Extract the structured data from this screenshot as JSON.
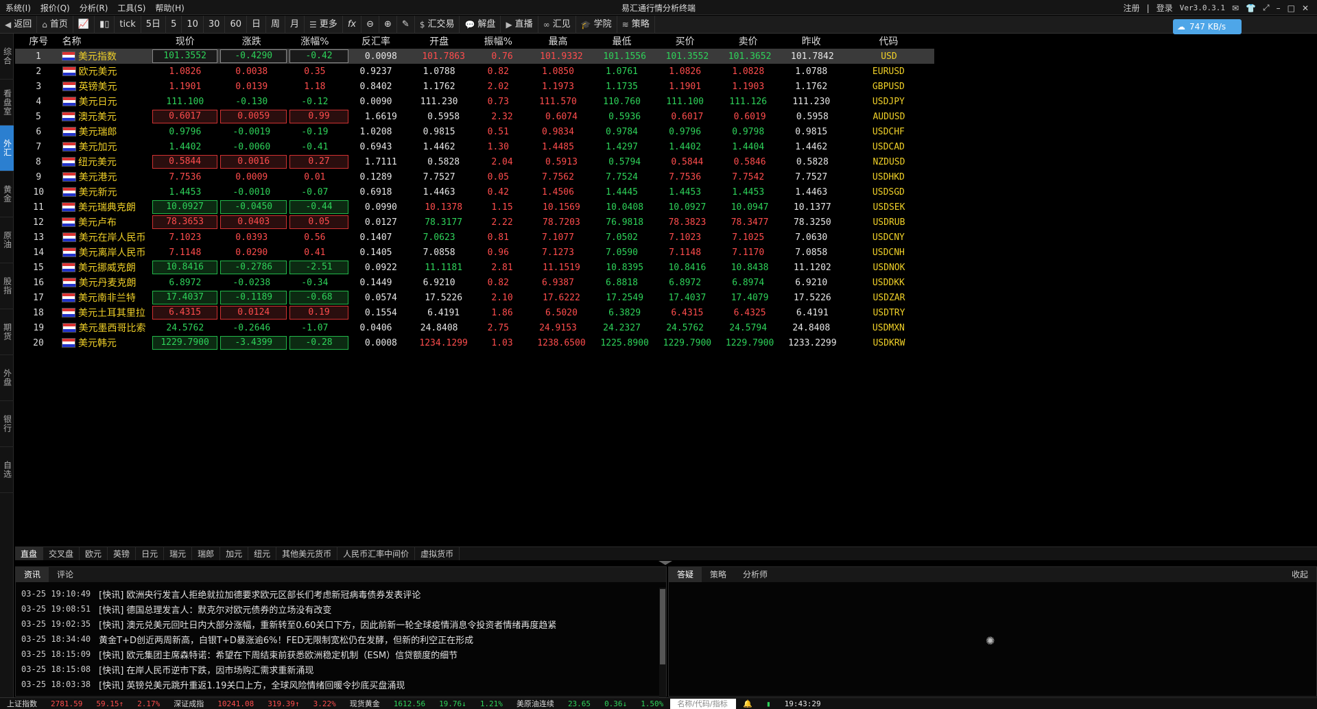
{
  "window": {
    "title": "易汇通行情分析终端",
    "version": "Ver3.0.3.1",
    "register": "注册",
    "login": "登录"
  },
  "menu": [
    "系统(I)",
    "报价(Q)",
    "分析(R)",
    "工具(S)",
    "帮助(H)"
  ],
  "toolbar": {
    "back": "返回",
    "home": "首页",
    "tick": "tick",
    "intervals": [
      "5日",
      "5",
      "10",
      "30",
      "60",
      "日",
      "周",
      "月"
    ],
    "more": "更多",
    "fx": "fx",
    "items": [
      "汇交易",
      "解盘",
      "直播",
      "汇见",
      "学院",
      "策略"
    ]
  },
  "speed": "747 KB/s",
  "sidebar": [
    "综合",
    "看盘室",
    "外汇",
    "黄金",
    "原油",
    "股指",
    "期货",
    "外盘",
    "银行",
    "自选"
  ],
  "columns": [
    "序号",
    "名称",
    "现价",
    "涨跌",
    "涨幅%",
    "反汇率",
    "开盘",
    "振幅%",
    "最高",
    "最低",
    "买价",
    "卖价",
    "昨收",
    "代码"
  ],
  "rows": [
    {
      "i": "1",
      "name": "美元指数",
      "price": "101.3552",
      "chg": "-0.4290",
      "pct": "-0.42",
      "inv": "0.0098",
      "open": "101.7863",
      "amp": "0.76",
      "high": "101.9332",
      "low": "101.1556",
      "bid": "101.3552",
      "ask": "101.3652",
      "prev": "101.7842",
      "code": "USD"
    },
    {
      "i": "2",
      "name": "欧元美元",
      "price": "1.0826",
      "chg": "0.0038",
      "pct": "0.35",
      "inv": "0.9237",
      "open": "1.0788",
      "amp": "0.82",
      "high": "1.0850",
      "low": "1.0761",
      "bid": "1.0826",
      "ask": "1.0828",
      "prev": "1.0788",
      "code": "EURUSD"
    },
    {
      "i": "3",
      "name": "英镑美元",
      "price": "1.1901",
      "chg": "0.0139",
      "pct": "1.18",
      "inv": "0.8402",
      "open": "1.1762",
      "amp": "2.02",
      "high": "1.1973",
      "low": "1.1735",
      "bid": "1.1901",
      "ask": "1.1903",
      "prev": "1.1762",
      "code": "GBPUSD"
    },
    {
      "i": "4",
      "name": "美元日元",
      "price": "111.100",
      "chg": "-0.130",
      "pct": "-0.12",
      "inv": "0.0090",
      "open": "111.230",
      "amp": "0.73",
      "high": "111.570",
      "low": "110.760",
      "bid": "111.100",
      "ask": "111.126",
      "prev": "111.230",
      "code": "USDJPY"
    },
    {
      "i": "5",
      "name": "澳元美元",
      "price": "0.6017",
      "chg": "0.0059",
      "pct": "0.99",
      "inv": "1.6619",
      "open": "0.5958",
      "amp": "2.32",
      "high": "0.6074",
      "low": "0.5936",
      "bid": "0.6017",
      "ask": "0.6019",
      "prev": "0.5958",
      "code": "AUDUSD"
    },
    {
      "i": "6",
      "name": "美元瑞郎",
      "price": "0.9796",
      "chg": "-0.0019",
      "pct": "-0.19",
      "inv": "1.0208",
      "open": "0.9815",
      "amp": "0.51",
      "high": "0.9834",
      "low": "0.9784",
      "bid": "0.9796",
      "ask": "0.9798",
      "prev": "0.9815",
      "code": "USDCHF"
    },
    {
      "i": "7",
      "name": "美元加元",
      "price": "1.4402",
      "chg": "-0.0060",
      "pct": "-0.41",
      "inv": "0.6943",
      "open": "1.4462",
      "amp": "1.30",
      "high": "1.4485",
      "low": "1.4297",
      "bid": "1.4402",
      "ask": "1.4404",
      "prev": "1.4462",
      "code": "USDCAD"
    },
    {
      "i": "8",
      "name": "纽元美元",
      "price": "0.5844",
      "chg": "0.0016",
      "pct": "0.27",
      "inv": "1.7111",
      "open": "0.5828",
      "amp": "2.04",
      "high": "0.5913",
      "low": "0.5794",
      "bid": "0.5844",
      "ask": "0.5846",
      "prev": "0.5828",
      "code": "NZDUSD"
    },
    {
      "i": "9",
      "name": "美元港元",
      "price": "7.7536",
      "chg": "0.0009",
      "pct": "0.01",
      "inv": "0.1289",
      "open": "7.7527",
      "amp": "0.05",
      "high": "7.7562",
      "low": "7.7524",
      "bid": "7.7536",
      "ask": "7.7542",
      "prev": "7.7527",
      "code": "USDHKD"
    },
    {
      "i": "10",
      "name": "美元新元",
      "price": "1.4453",
      "chg": "-0.0010",
      "pct": "-0.07",
      "inv": "0.6918",
      "open": "1.4463",
      "amp": "0.42",
      "high": "1.4506",
      "low": "1.4445",
      "bid": "1.4453",
      "ask": "1.4453",
      "prev": "1.4463",
      "code": "USDSGD"
    },
    {
      "i": "11",
      "name": "美元瑞典克朗",
      "price": "10.0927",
      "chg": "-0.0450",
      "pct": "-0.44",
      "inv": "0.0990",
      "open": "10.1378",
      "amp": "1.15",
      "high": "10.1569",
      "low": "10.0408",
      "bid": "10.0927",
      "ask": "10.0947",
      "prev": "10.1377",
      "code": "USDSEK"
    },
    {
      "i": "12",
      "name": "美元卢布",
      "price": "78.3653",
      "chg": "0.0403",
      "pct": "0.05",
      "inv": "0.0127",
      "open": "78.3177",
      "amp": "2.22",
      "high": "78.7203",
      "low": "76.9818",
      "bid": "78.3823",
      "ask": "78.3477",
      "prev": "78.3250",
      "code": "USDRUB"
    },
    {
      "i": "13",
      "name": "美元在岸人民币",
      "price": "7.1023",
      "chg": "0.0393",
      "pct": "0.56",
      "inv": "0.1407",
      "open": "7.0623",
      "amp": "0.81",
      "high": "7.1077",
      "low": "7.0502",
      "bid": "7.1023",
      "ask": "7.1025",
      "prev": "7.0630",
      "code": "USDCNY"
    },
    {
      "i": "14",
      "name": "美元离岸人民币",
      "price": "7.1148",
      "chg": "0.0290",
      "pct": "0.41",
      "inv": "0.1405",
      "open": "7.0858",
      "amp": "0.96",
      "high": "7.1273",
      "low": "7.0590",
      "bid": "7.1148",
      "ask": "7.1170",
      "prev": "7.0858",
      "code": "USDCNH"
    },
    {
      "i": "15",
      "name": "美元挪威克朗",
      "price": "10.8416",
      "chg": "-0.2786",
      "pct": "-2.51",
      "inv": "0.0922",
      "open": "11.1181",
      "amp": "2.81",
      "high": "11.1519",
      "low": "10.8395",
      "bid": "10.8416",
      "ask": "10.8438",
      "prev": "11.1202",
      "code": "USDNOK"
    },
    {
      "i": "16",
      "name": "美元丹麦克朗",
      "price": "6.8972",
      "chg": "-0.0238",
      "pct": "-0.34",
      "inv": "0.1449",
      "open": "6.9210",
      "amp": "0.82",
      "high": "6.9387",
      "low": "6.8818",
      "bid": "6.8972",
      "ask": "6.8974",
      "prev": "6.9210",
      "code": "USDDKK"
    },
    {
      "i": "17",
      "name": "美元南非兰特",
      "price": "17.4037",
      "chg": "-0.1189",
      "pct": "-0.68",
      "inv": "0.0574",
      "open": "17.5226",
      "amp": "2.10",
      "high": "17.6222",
      "low": "17.2549",
      "bid": "17.4037",
      "ask": "17.4079",
      "prev": "17.5226",
      "code": "USDZAR"
    },
    {
      "i": "18",
      "name": "美元土耳其里拉",
      "price": "6.4315",
      "chg": "0.0124",
      "pct": "0.19",
      "inv": "0.1554",
      "open": "6.4191",
      "amp": "1.86",
      "high": "6.5020",
      "low": "6.3829",
      "bid": "6.4315",
      "ask": "6.4325",
      "prev": "6.4191",
      "code": "USDTRY"
    },
    {
      "i": "19",
      "name": "美元墨西哥比索",
      "price": "24.5762",
      "chg": "-0.2646",
      "pct": "-1.07",
      "inv": "0.0406",
      "open": "24.8408",
      "amp": "2.75",
      "high": "24.9153",
      "low": "24.2327",
      "bid": "24.5762",
      "ask": "24.5794",
      "prev": "24.8408",
      "code": "USDMXN"
    },
    {
      "i": "20",
      "name": "美元韩元",
      "price": "1229.7900",
      "chg": "-3.4399",
      "pct": "-0.28",
      "inv": "0.0008",
      "open": "1234.1299",
      "amp": "1.03",
      "high": "1238.6500",
      "low": "1225.8900",
      "bid": "1229.7900",
      "ask": "1229.7900",
      "prev": "1233.2299",
      "code": "USDKRW"
    }
  ],
  "bottom_tabs": [
    "直盘",
    "交叉盘",
    "欧元",
    "英镑",
    "日元",
    "瑞元",
    "瑞郎",
    "加元",
    "纽元",
    "其他美元货币",
    "人民币汇率中间价",
    "虚拟货币"
  ],
  "news": {
    "tabs": [
      "资讯",
      "评论"
    ],
    "items": [
      {
        "t": "03-25 19:10:49",
        "text": "[快讯] 欧洲央行发言人拒绝就拉加德要求欧元区部长们考虑新冠病毒债券发表评论"
      },
      {
        "t": "03-25 19:08:51",
        "text": "[快讯] 德国总理发言人：默克尔对欧元债券的立场没有改变"
      },
      {
        "t": "03-25 19:02:35",
        "text": "[快讯] 澳元兑美元回吐日内大部分涨幅，重新转至0.60关口下方，因此前新一轮全球疫情消息令投资者情绪再度趋紧"
      },
      {
        "t": "03-25 18:34:40",
        "text": "黄金T+D创近两周新高，白银T+D暴涨逾6%！FED无限制宽松仍在发酵，但新的利空正在形成"
      },
      {
        "t": "03-25 18:15:09",
        "text": "[快讯] 欧元集团主席森特诺：希望在下周结束前获悉欧洲稳定机制（ESM）信贷额度的细节"
      },
      {
        "t": "03-25 18:15:08",
        "text": "[快讯] 在岸人民币逆市下跌，因市场购汇需求重新涌现"
      },
      {
        "t": "03-25 18:03:38",
        "text": "[快讯] 英镑兑美元跳升重返1.19关口上方，全球风险情绪回暖令抄底买盘涌现"
      }
    ]
  },
  "right_panel": {
    "tabs": [
      "答疑",
      "策略",
      "分析师"
    ],
    "collapse": "收起"
  },
  "ticker": [
    {
      "name": "上证指数",
      "v1": "2781.59",
      "v2": "59.15↑",
      "v3": "2.17%"
    },
    {
      "name": "深证成指",
      "v1": "10241.08",
      "v2": "319.39↑",
      "v3": "3.22%"
    },
    {
      "name": "现货黄金",
      "v1": "1612.56",
      "v2": "19.76↓",
      "v3": "1.21%"
    },
    {
      "name": "美原油连续",
      "v1": "23.65",
      "v2": "0.36↓",
      "v3": "1.50%"
    }
  ],
  "search_placeholder": "名称/代码/指标",
  "clock": "19:43:29"
}
